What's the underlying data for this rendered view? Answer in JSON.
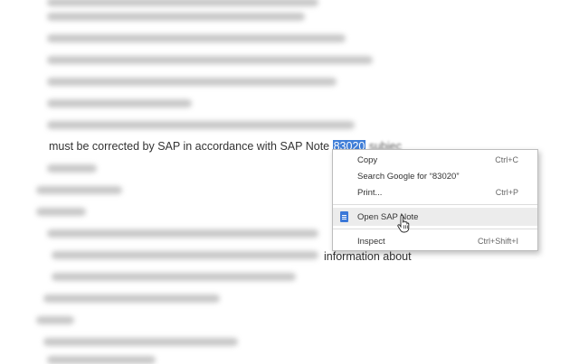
{
  "document": {
    "line_visible": "must be corrected by SAP in accordance with SAP Note ",
    "selected_text": "83020",
    "line_trailing": "subjec",
    "partial_line_end": "information about"
  },
  "context_menu": {
    "items": [
      {
        "label": "Copy",
        "shortcut": "Ctrl+C"
      },
      {
        "label": "Search Google for “83020”",
        "shortcut": ""
      },
      {
        "label": "Print...",
        "shortcut": "Ctrl+P"
      },
      {
        "label": "Open SAP Note",
        "shortcut": "",
        "icon": "sap-note-icon"
      },
      {
        "label": "Inspect",
        "shortcut": "Ctrl+Shift+I"
      }
    ]
  },
  "colors": {
    "selection": "#3f7ed8",
    "menu_hover": "#ececec",
    "icon": "#3b78d8"
  }
}
